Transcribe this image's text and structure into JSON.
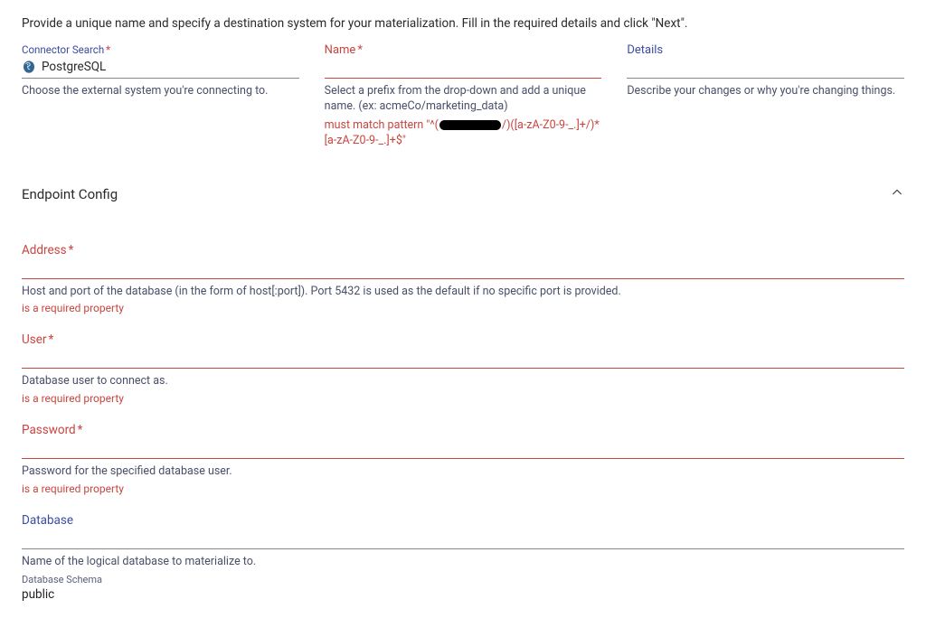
{
  "intro": "Provide a unique name and specify a destination system for your materialization. Fill in the required details and click \"Next\".",
  "top": {
    "connector": {
      "label": "Connector Search",
      "required": "*",
      "value": "PostgreSQL",
      "helper": "Choose the external system you're connecting to."
    },
    "name": {
      "label": "Name",
      "required": "*",
      "helper": "Select a prefix from the drop-down and add a unique name. (ex: acmeCo/marketing_data)",
      "pattern_prefix": "must match pattern \"^(",
      "pattern_suffix": "/)([a-zA-Z0-9-_.]+/)*[a-zA-Z0-9-_.]+$\""
    },
    "details": {
      "label": "Details",
      "helper": "Describe your changes or why you're changing things."
    }
  },
  "section": {
    "title": "Endpoint Config"
  },
  "fields": {
    "address": {
      "label": "Address",
      "required": "*",
      "helper": "Host and port of the database (in the form of host[:port]). Port 5432 is used as the default if no specific port is provided.",
      "err": "is a required property"
    },
    "user": {
      "label": "User",
      "required": "*",
      "helper": "Database user to connect as.",
      "err": "is a required property"
    },
    "password": {
      "label": "Password",
      "required": "*",
      "helper": "Password for the specified database user.",
      "err": "is a required property"
    },
    "database": {
      "label": "Database",
      "helper": "Name of the logical database to materialize to.",
      "schema_label": "Database Schema",
      "schema_value": "public"
    }
  }
}
